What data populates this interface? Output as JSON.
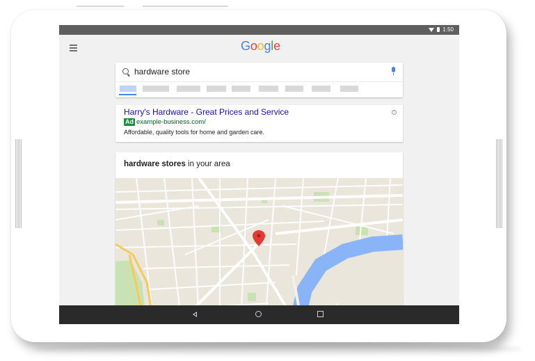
{
  "status_bar": {
    "time": "1:50"
  },
  "header": {
    "logo_letters": [
      {
        "char": "G",
        "color": "#4285f4"
      },
      {
        "char": "o",
        "color": "#ea4335"
      },
      {
        "char": "o",
        "color": "#fbbc05"
      },
      {
        "char": "g",
        "color": "#4285f4"
      },
      {
        "char": "l",
        "color": "#34a853"
      },
      {
        "char": "e",
        "color": "#ea4335"
      }
    ]
  },
  "search": {
    "query": "hardware store"
  },
  "ad": {
    "title": "Harry's Hardware - Great Prices and Service",
    "badge": "Ad",
    "url": "example-business.com/",
    "description": "Affordable, quality tools for home and garden care."
  },
  "local": {
    "title_bold": "hardware stores",
    "title_rest": " in your area"
  },
  "colors": {
    "ad_title": "#1a0dab",
    "ad_badge": "#1e8e3e",
    "map_pin": "#e53935",
    "river": "#8ab4f8"
  }
}
